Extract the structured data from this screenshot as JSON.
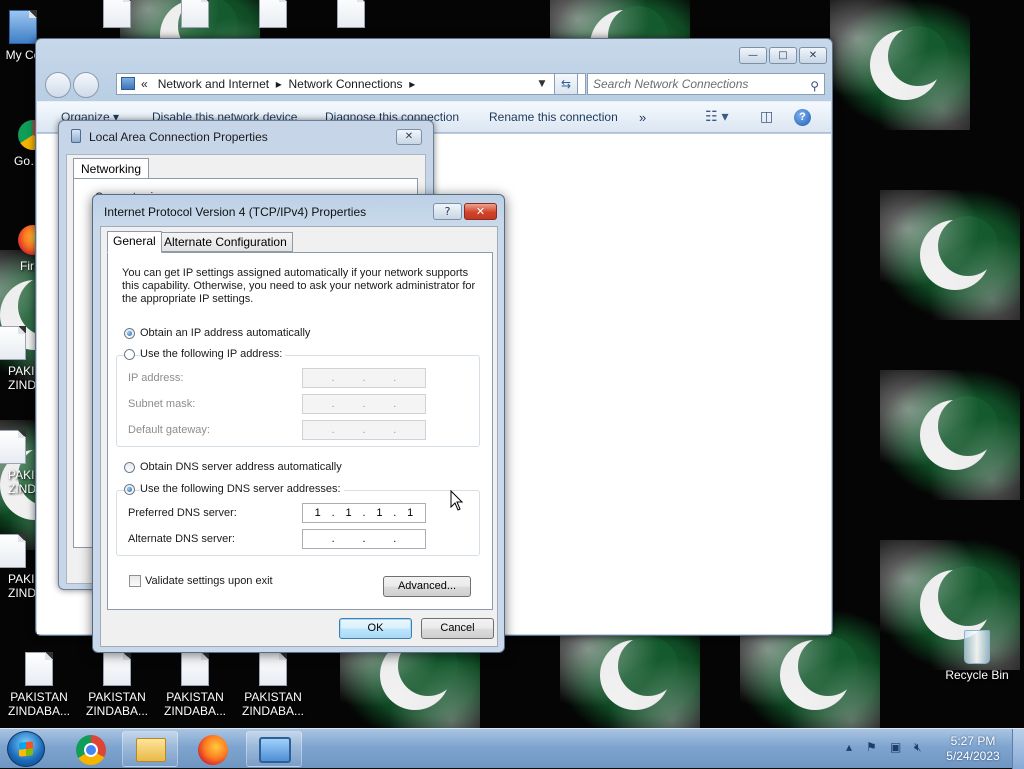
{
  "desktop": {
    "left_icons": [
      {
        "label": "My Co"
      },
      {
        "label": "Go… Chr"
      },
      {
        "label": "Fir"
      },
      {
        "label": "PAKI ZIND"
      },
      {
        "label": "PAKI ZIND"
      },
      {
        "label": "PAKI ZIND"
      }
    ],
    "bottom_icons": [
      {
        "label1": "PAKISTAN",
        "label2": "ZINDABA..."
      },
      {
        "label1": "PAKISTAN",
        "label2": "ZINDABA..."
      },
      {
        "label1": "PAKISTAN",
        "label2": "ZINDABA..."
      },
      {
        "label1": "PAKISTAN",
        "label2": "ZINDABA..."
      }
    ],
    "recycle_bin": "Recycle Bin"
  },
  "explorer": {
    "breadcrumb_prefix": "«",
    "breadcrumb": [
      "Network and Internet",
      "Network Connections"
    ],
    "breadcrumb_sep": "▸",
    "search_placeholder": "Search Network Connections",
    "commands": {
      "organize": "Organize ▾",
      "disable": "Disable this network device",
      "diagnose": "Diagnose this connection",
      "rename": "Rename this connection",
      "more": "»"
    },
    "controls": {
      "minimize": "—",
      "maximize": "□",
      "close": "✕"
    }
  },
  "lac_dialog": {
    "title": "Local Area Connection Properties",
    "tab": "Networking",
    "close": "✕",
    "partial_label": "Connect using:",
    "partial_t": "T"
  },
  "ipv4_dialog": {
    "title": "Internet Protocol Version 4 (TCP/IPv4) Properties",
    "help": "?",
    "close": "✕",
    "tabs": {
      "general": "General",
      "alternate": "Alternate Configuration"
    },
    "info_text": "You can get IP settings assigned automatically if your network supports this capability. Otherwise, you need to ask your network administrator for the appropriate IP settings.",
    "ip_auto": "Obtain an IP address automatically",
    "ip_manual": "Use the following IP address:",
    "ip_address_label": "IP address:",
    "subnet_label": "Subnet mask:",
    "gateway_label": "Default gateway:",
    "dns_auto": "Obtain DNS server address automatically",
    "dns_manual": "Use the following DNS server addresses:",
    "preferred_dns_label": "Preferred DNS server:",
    "preferred_dns": [
      "1",
      "1",
      "1",
      "1"
    ],
    "alternate_dns_label": "Alternate DNS server:",
    "validate_label": "Validate settings upon exit",
    "advanced": "Advanced...",
    "ok": "OK",
    "cancel": "Cancel"
  },
  "taskbar": {
    "time": "5:27 PM",
    "date": "5/24/2023",
    "tray_arrow": "▴"
  }
}
